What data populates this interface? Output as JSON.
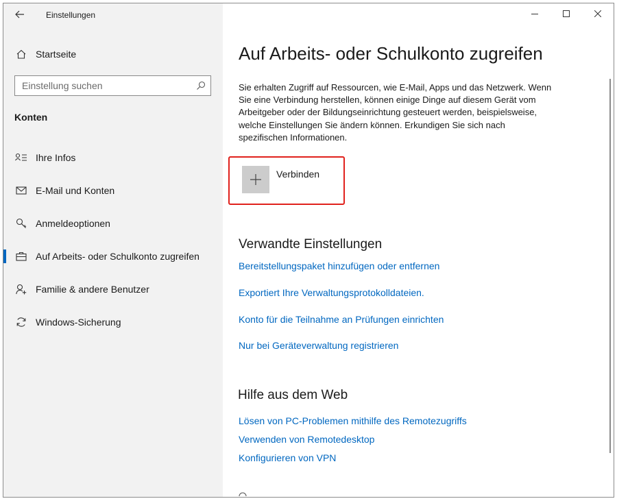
{
  "window": {
    "title": "Einstellungen"
  },
  "sidebar": {
    "home_label": "Startseite",
    "search_placeholder": "Einstellung suchen",
    "section_title": "Konten",
    "items": [
      {
        "label": "Ihre Infos",
        "icon": "person-card-icon"
      },
      {
        "label": "E-Mail und Konten",
        "icon": "mail-icon"
      },
      {
        "label": "Anmeldeoptionen",
        "icon": "key-icon"
      },
      {
        "label": "Auf Arbeits- oder Schulkonto zugreifen",
        "icon": "briefcase-icon",
        "active": true
      },
      {
        "label": "Familie & andere Benutzer",
        "icon": "person-add-icon"
      },
      {
        "label": "Windows-Sicherung",
        "icon": "sync-icon"
      }
    ]
  },
  "main": {
    "title": "Auf Arbeits- oder Schulkonto zugreifen",
    "description": "Sie erhalten Zugriff auf Ressourcen, wie E-Mail, Apps und das Netzwerk. Wenn Sie eine Verbindung herstellen, können einige Dinge auf diesem Gerät vom Arbeitgeber oder der Bildungseinrichtung gesteuert werden, beispielsweise, welche Einstellungen Sie ändern können. Erkundigen Sie sich nach spezifischen Informationen.",
    "connect_label": "Verbinden",
    "related": {
      "title": "Verwandte Einstellungen",
      "links": [
        "Bereitstellungspaket hinzufügen oder entfernen",
        "Exportiert Ihre Verwaltungsprotokolldateien.",
        "Konto für die Teilnahme an Prüfungen einrichten",
        "Nur bei Geräteverwaltung registrieren"
      ]
    },
    "help": {
      "title": "Hilfe aus dem Web",
      "links": [
        "Lösen von PC-Problemen mithilfe des Remotezugriffs",
        "Verwenden von Remotedesktop",
        "Konfigurieren von VPN"
      ]
    }
  },
  "colors": {
    "accent": "#0067c0",
    "highlight": "#e0201b",
    "sidebar_bg": "#f2f2f2"
  }
}
